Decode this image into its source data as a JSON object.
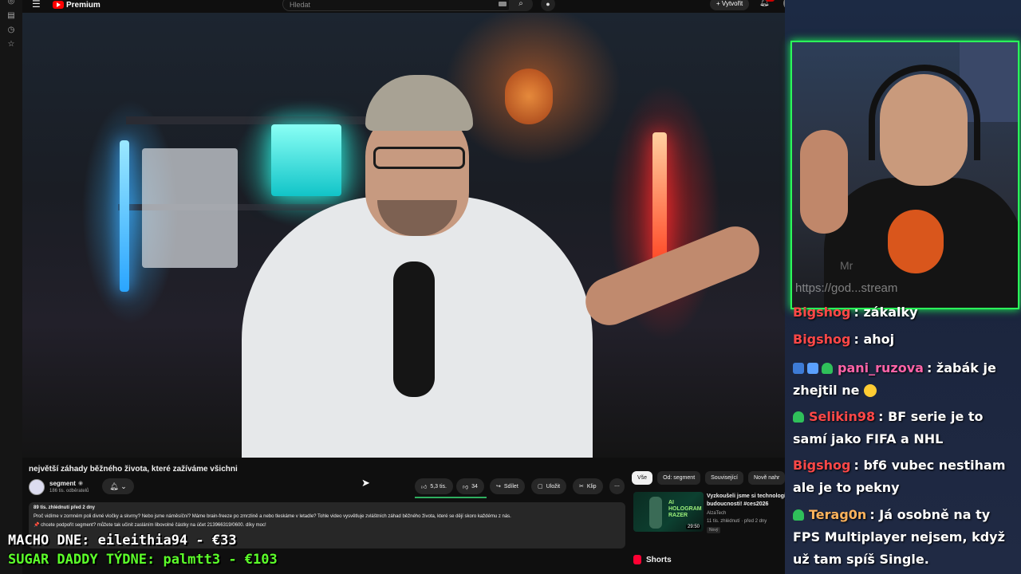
{
  "colors": {
    "accent_red": "#ff0000",
    "webcam_border": "#2bff5a",
    "like_bar": "#2fae5f",
    "overlay_green": "#5cff2a",
    "chat_user": "#ff4848",
    "chat_user2": "#ff63a8",
    "chat_user3": "#ffb35c"
  },
  "left_rail": {
    "icons": [
      "compass-icon",
      "library-icon",
      "history-icon",
      "star-icon"
    ]
  },
  "topbar": {
    "logo_text": "Premium",
    "search_placeholder": "Hledat",
    "create_label": "Vytvořit",
    "notif_count": "9+"
  },
  "video": {
    "title": "největší záhady běžného života, které zažíváme všichni",
    "channel": {
      "name": "segment",
      "subscribers": "186 tis. odběratelů"
    },
    "actions": {
      "likes": "5,3 tis.",
      "dislikes": "34",
      "share": "Sdílet",
      "save": "Uložit",
      "clip": "Klip"
    },
    "description": {
      "meta": "89 tis. zhlédnutí  před 2 dny",
      "line1": "Proč vidíme v zornném poli divné vločky a skvrny? Nebo jsme náměsíční? Máme brain-freeze po zmrzlině a nebo tleskáme v letadle? Tohle video vysvětluje zvláštních záhad běžného života, které se dějí skoro každému z nás.",
      "line2": "📌 chcete podpořit segment? můžete tak učinit zasláním libovolné částky na účet 213966319/0600. díky moc!"
    }
  },
  "sidebar": {
    "chips": [
      "Vše",
      "Od: segment",
      "Související",
      "Nově nahr"
    ],
    "rec": {
      "thumb_title": "AI HOLOGRAM RAZER",
      "duration": "29:50",
      "title": "Vyzkoušeli jsme si technologie budoucnosti! #ces2026",
      "channel": "AlzaTech",
      "meta": "11 tis. zhlédnutí · před 2 dny",
      "badge": "Nový"
    },
    "shorts_label": "Shorts"
  },
  "stream": {
    "webcam_watermark_1": "Mr",
    "webcam_watermark_2": "https://god...stream",
    "chat": [
      {
        "user": "Bigshog",
        "text": ": zákalky",
        "badges": ""
      },
      {
        "user": "Bigshog",
        "text": ": ahoj",
        "badges": ""
      },
      {
        "user": "pani_ruzova",
        "text": ": žabák je zhejtil ne",
        "badges": "multi"
      },
      {
        "user": "Selikin98",
        "text": ": BF serie je to samí jako FIFA a NHL",
        "badges": "green"
      },
      {
        "user": "Bigshog",
        "text": ": bf6 vubec nestiham ale je to pekny",
        "badges": ""
      },
      {
        "user": "Terag0n",
        "text": ": Já osobně na ty FPS Multiplayer nejsem, když už tam spíš Single.",
        "badges": "green"
      }
    ],
    "overlay_line1": "MACHO DNE: eileithia94 - €33",
    "overlay_line2": "SUGAR DADDY TÝDNE: palmtt3 - €103"
  }
}
